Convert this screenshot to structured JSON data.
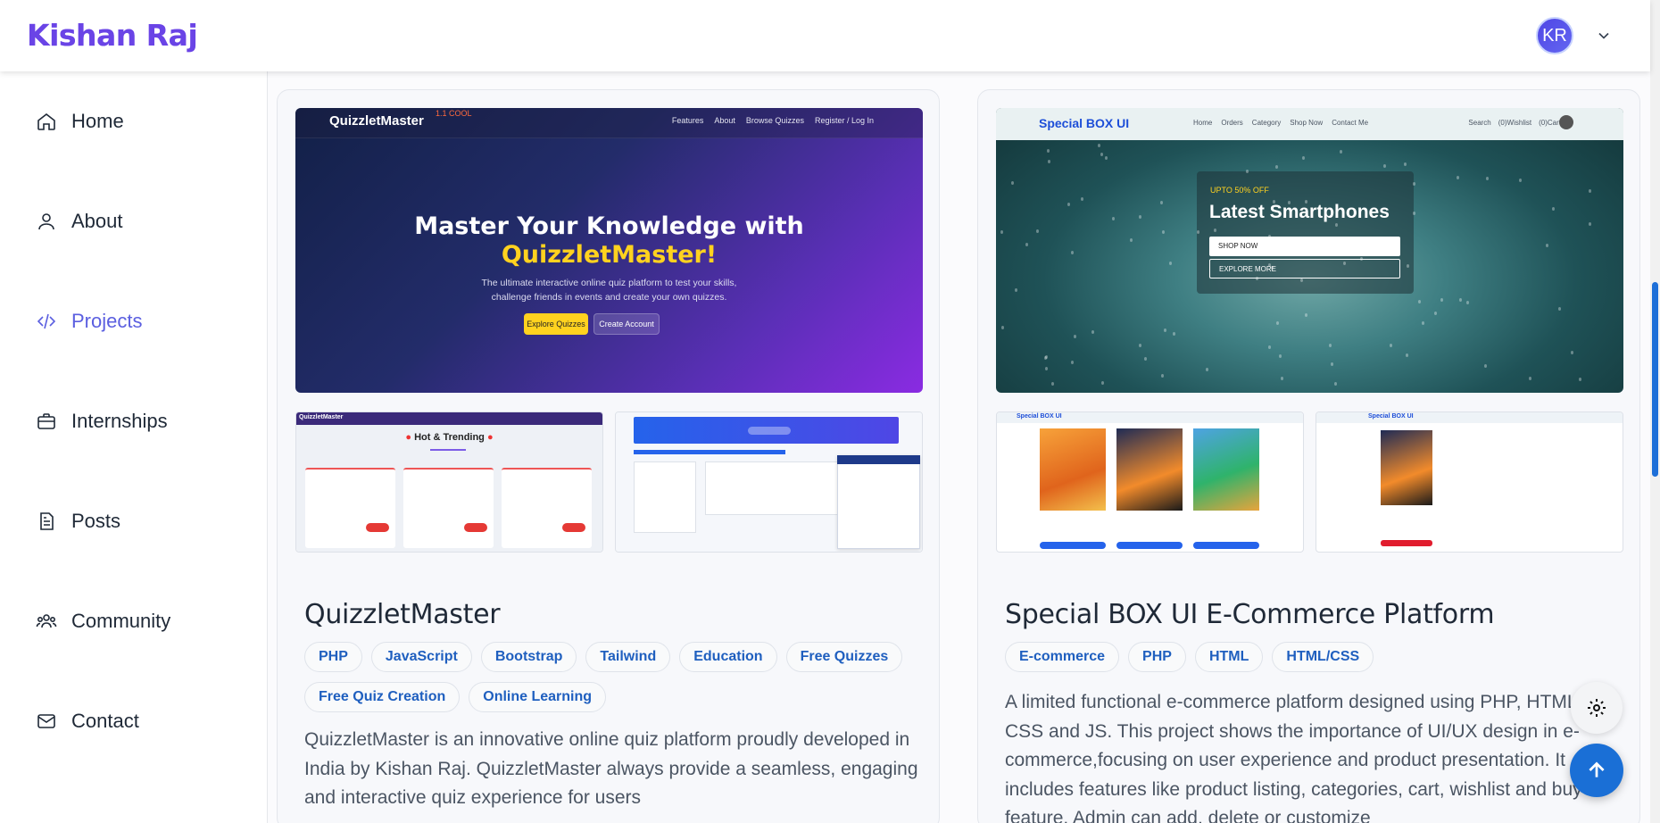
{
  "header": {
    "brand": "Kishan Raj",
    "avatar_initials": "KR"
  },
  "sidebar": {
    "items": [
      {
        "label": "Home",
        "icon": "home-icon"
      },
      {
        "label": "About",
        "icon": "user-icon"
      },
      {
        "label": "Projects",
        "icon": "code-icon",
        "active": true
      },
      {
        "label": "Internships",
        "icon": "briefcase-icon"
      },
      {
        "label": "Posts",
        "icon": "document-icon"
      },
      {
        "label": "Community",
        "icon": "users-icon"
      },
      {
        "label": "Contact",
        "icon": "mail-icon"
      }
    ]
  },
  "projects": [
    {
      "title": "QuizzletMaster",
      "tags": [
        "PHP",
        "JavaScript",
        "Bootstrap",
        "Tailwind",
        "Education",
        "Free Quizzes",
        "Free Quiz Creation",
        "Online Learning"
      ],
      "description": "QuizzletMaster is an innovative online quiz platform proudly developed in India by Kishan Raj. QuizzletMaster always provide a seamless, engaging and interactive quiz experience for users",
      "preview": {
        "logo": "QuizzletMaster",
        "badge": "1.1 COOL",
        "nav": [
          "Features",
          "About",
          "Browse Quizzes",
          "Register / Log In"
        ],
        "headline_1": "Master Your Knowledge with",
        "headline_2": "QuizzletMaster!",
        "subtitle_1": "The ultimate interactive online quiz platform to test your skills,",
        "subtitle_2": "challenge friends in events and create your own quizzes.",
        "btn_primary": "Explore Quizzes",
        "btn_secondary": "Create Account",
        "thumb_heading": "Hot & Trending"
      }
    },
    {
      "title": "Special BOX UI E-Commerce Platform",
      "tags": [
        "E-commerce",
        "PHP",
        "HTML",
        "HTML/CSS"
      ],
      "description": "A limited functional e-commerce platform designed using PHP, HTML, CSS and JS. This project shows the importance of UI/UX design in e-commerce,focusing on user experience and product presentation. It includes features like product listing, categories, cart, wishlist and buy feature. Admin can add, delete or customize",
      "preview": {
        "logo": "Special BOX UI",
        "nav": [
          "Home",
          "Orders",
          "Category",
          "Shop Now",
          "Contact Me"
        ],
        "right_nav": [
          "Search",
          "(0)Wishlist",
          "(0)Cart"
        ],
        "promo": "UPTO 50% OFF",
        "headline": "Latest Smartphones",
        "btn_primary": "SHOP NOW",
        "btn_secondary": "EXPLORE MORE"
      }
    }
  ],
  "colors": {
    "accent": "#5b5fe0",
    "brand": "#6a44e6",
    "fab": "#1a6fd6",
    "tag_text": "#1f5fbf"
  }
}
